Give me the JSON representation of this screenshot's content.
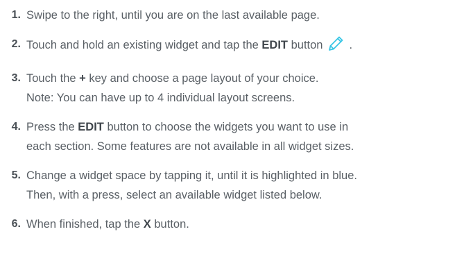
{
  "steps": [
    {
      "number": "1.",
      "text": "Swipe to the right, until you are on the last available page."
    },
    {
      "number": "2.",
      "before": "Touch and hold an existing widget and tap the ",
      "keyword": "EDIT",
      "after": " button",
      "icon": "pencil-icon",
      "trail": "."
    },
    {
      "number": "3.",
      "before": "Touch the ",
      "keyword": "+",
      "after": " key and choose a page layout of your choice.",
      "line2": "Note: You can have up to 4 individual layout screens."
    },
    {
      "number": "4.",
      "before": "Press the ",
      "keyword": "EDIT",
      "after": " button to choose the widgets you want to use in",
      "line2": "each section. Some features are not available in all widget sizes."
    },
    {
      "number": "5.",
      "line1": "Change a widget space by tapping it, until it is highlighted in blue.",
      "line2": "Then, with a press, select an available widget listed below."
    },
    {
      "number": "6.",
      "before": "When finished, tap the ",
      "keyword": "X",
      "after": " button."
    }
  ],
  "colors": {
    "text": "#595f65",
    "number": "#4a5056",
    "keyword": "#3f454b",
    "icon_accent": "#39c6e6"
  }
}
